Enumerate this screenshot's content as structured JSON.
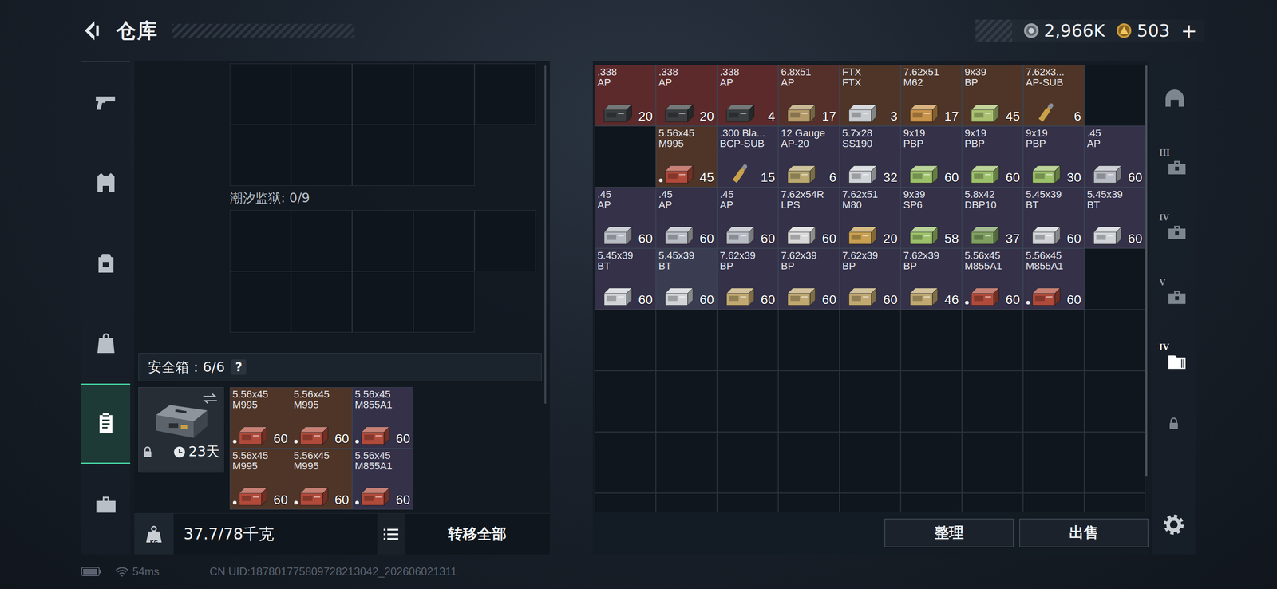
{
  "header": {
    "title": "仓库",
    "currencies": [
      {
        "kind": "silver",
        "value": "2,966K"
      },
      {
        "kind": "gold",
        "value": "503"
      }
    ],
    "add": "+"
  },
  "nav": [
    {
      "kind": "pistol",
      "selected": false
    },
    {
      "kind": "vest",
      "selected": false
    },
    {
      "kind": "rig",
      "selected": false
    },
    {
      "kind": "bag",
      "selected": false
    },
    {
      "kind": "case",
      "selected": true
    },
    {
      "kind": "toolbox",
      "selected": false
    }
  ],
  "loadout": {
    "prison_label": "潮汐监狱: 0/9",
    "secure": {
      "label": "安全箱：6/6",
      "help": "?",
      "days": "23天",
      "locked": true,
      "items": [
        {
          "kind": "box",
          "caliber": "5.56x45",
          "type": "M995",
          "count": "60",
          "color": "#4e3528",
          "box_color": "#b04a3a",
          "marked": true
        },
        {
          "kind": "box",
          "caliber": "5.56x45",
          "type": "M995",
          "count": "60",
          "color": "#4e3528",
          "box_color": "#b04a3a",
          "marked": true
        },
        {
          "kind": "box",
          "caliber": "5.56x45",
          "type": "M855A1",
          "count": "60",
          "color": "#343149",
          "box_color": "#b04a3a",
          "marked": true
        },
        {
          "kind": "box",
          "caliber": "5.56x45",
          "type": "M995",
          "count": "60",
          "color": "#4e3528",
          "box_color": "#b04a3a",
          "marked": true
        },
        {
          "kind": "box",
          "caliber": "5.56x45",
          "type": "M995",
          "count": "60",
          "color": "#4e3528",
          "box_color": "#b04a3a",
          "marked": true
        },
        {
          "kind": "box",
          "caliber": "5.56x45",
          "type": "M855A1",
          "count": "60",
          "color": "#343149",
          "box_color": "#b04a3a",
          "marked": true
        }
      ]
    },
    "weight_icon": "KG",
    "weight": "37.7/78千克",
    "transfer": "转移全部"
  },
  "stash": {
    "rows": [
      [
        {
          "kind": "box",
          "caliber": ".338",
          "type": "AP",
          "count": "20",
          "color": "#5c2a2b",
          "box_color": "#3a3e40",
          "marked": false
        },
        {
          "kind": "box",
          "caliber": ".338",
          "type": "AP",
          "count": "20",
          "color": "#5c2a2b",
          "box_color": "#3a3e40",
          "marked": false
        },
        {
          "kind": "box",
          "caliber": ".338",
          "type": "AP",
          "count": "4",
          "color": "#5c2a2b",
          "box_color": "#3a3e40",
          "marked": false
        },
        {
          "kind": "box",
          "caliber": "6.8x51",
          "type": "AP",
          "count": "17",
          "color": "#55302b",
          "box_color": "#b49a68",
          "marked": false
        },
        {
          "kind": "box",
          "caliber": "FTX",
          "type": "FTX",
          "count": "3",
          "color": "#4e3528",
          "box_color": "#c8ccd0",
          "marked": false
        },
        {
          "kind": "box",
          "caliber": "7.62x51",
          "type": "M62",
          "count": "17",
          "color": "#4e3528",
          "box_color": "#c8924a",
          "marked": false
        },
        {
          "kind": "box",
          "caliber": "9x39",
          "type": "BP",
          "count": "45",
          "color": "#4e3528",
          "box_color": "#a8c070",
          "marked": false
        },
        {
          "kind": "round",
          "caliber": "7.62x3...",
          "type": "AP-SUB",
          "count": "6",
          "color": "#4e3528",
          "box_color": "#c9a24a",
          "marked": false
        },
        {
          "kind": "empty"
        }
      ],
      [
        {
          "kind": "empty"
        },
        {
          "kind": "box",
          "caliber": "5.56x45",
          "type": "M995",
          "count": "45",
          "color": "#4e3528",
          "box_color": "#b04a3a",
          "marked": true
        },
        {
          "kind": "round",
          "caliber": ".300 Bla...",
          "type": "BCP-SUB",
          "count": "15",
          "color": "#343149",
          "box_color": "#c9a24a",
          "marked": false
        },
        {
          "kind": "box",
          "caliber": "12 Gauge",
          "type": "AP-20",
          "count": "6",
          "color": "#343149",
          "box_color": "#b9a870",
          "marked": false
        },
        {
          "kind": "box",
          "caliber": "5.7x28",
          "type": "SS190",
          "count": "32",
          "color": "#343149",
          "box_color": "#d0d4d8",
          "marked": false
        },
        {
          "kind": "box",
          "caliber": "9x19",
          "type": "PBP",
          "count": "60",
          "color": "#343149",
          "box_color": "#9cc06a",
          "marked": false
        },
        {
          "kind": "box",
          "caliber": "9x19",
          "type": "PBP",
          "count": "60",
          "color": "#343149",
          "box_color": "#9cc06a",
          "marked": false
        },
        {
          "kind": "box",
          "caliber": "9x19",
          "type": "PBP",
          "count": "30",
          "color": "#343149",
          "box_color": "#9cc06a",
          "marked": false
        },
        {
          "kind": "box",
          "caliber": ".45",
          "type": "AP",
          "count": "60",
          "color": "#343149",
          "box_color": "#b8bcc4",
          "marked": false
        }
      ],
      [
        {
          "kind": "box",
          "caliber": ".45",
          "type": "AP",
          "count": "60",
          "color": "#343149",
          "box_color": "#b8bcc4",
          "marked": false
        },
        {
          "kind": "box",
          "caliber": ".45",
          "type": "AP",
          "count": "60",
          "color": "#343149",
          "box_color": "#b8bcc4",
          "marked": false
        },
        {
          "kind": "box",
          "caliber": ".45",
          "type": "AP",
          "count": "60",
          "color": "#343149",
          "box_color": "#b8bcc4",
          "marked": false
        },
        {
          "kind": "box",
          "caliber": "7.62x54R",
          "type": "LPS",
          "count": "60",
          "color": "#343149",
          "box_color": "#d8d8d8",
          "marked": false
        },
        {
          "kind": "box",
          "caliber": "7.62x51",
          "type": "M80",
          "count": "20",
          "color": "#343149",
          "box_color": "#c8a050",
          "marked": false
        },
        {
          "kind": "box",
          "caliber": "9x39",
          "type": "SP6",
          "count": "58",
          "color": "#343149",
          "box_color": "#9cc06a",
          "marked": false
        },
        {
          "kind": "box",
          "caliber": "5.8x42",
          "type": "DBP10",
          "count": "37",
          "color": "#343149",
          "box_color": "#7fa060",
          "marked": false
        },
        {
          "kind": "box",
          "caliber": "5.45x39",
          "type": "BT",
          "count": "60",
          "color": "#343149",
          "box_color": "#d0d4d8",
          "marked": false
        },
        {
          "kind": "box",
          "caliber": "5.45x39",
          "type": "BT",
          "count": "60",
          "color": "#343149",
          "box_color": "#d0d4d8",
          "marked": false
        }
      ],
      [
        {
          "kind": "box",
          "caliber": "5.45x39",
          "type": "BT",
          "count": "60",
          "color": "#343149",
          "box_color": "#d0d4d8",
          "marked": false
        },
        {
          "kind": "box",
          "caliber": "5.45x39",
          "type": "BT",
          "count": "60",
          "color": "#3a3d52",
          "box_color": "#d0d4d8",
          "marked": false
        },
        {
          "kind": "box",
          "caliber": "7.62x39",
          "type": "BP",
          "count": "60",
          "color": "#343149",
          "box_color": "#c0a870",
          "marked": false
        },
        {
          "kind": "box",
          "caliber": "7.62x39",
          "type": "BP",
          "count": "60",
          "color": "#343149",
          "box_color": "#c0a870",
          "marked": false
        },
        {
          "kind": "box",
          "caliber": "7.62x39",
          "type": "BP",
          "count": "60",
          "color": "#343149",
          "box_color": "#c0a870",
          "marked": false
        },
        {
          "kind": "box",
          "caliber": "7.62x39",
          "type": "BP",
          "count": "46",
          "color": "#343149",
          "box_color": "#c0a870",
          "marked": false
        },
        {
          "kind": "box",
          "caliber": "5.56x45",
          "type": "M855A1",
          "count": "60",
          "color": "#343149",
          "box_color": "#b04a3a",
          "marked": true
        },
        {
          "kind": "box",
          "caliber": "5.56x45",
          "type": "M855A1",
          "count": "60",
          "color": "#343149",
          "box_color": "#b04a3a",
          "marked": true
        },
        {
          "kind": "empty"
        }
      ]
    ]
  },
  "actions": [
    {
      "label": "整理"
    },
    {
      "label": "出售"
    }
  ],
  "side_tabs": [
    {
      "kind": "raid",
      "selected": false
    },
    {
      "kind": "case",
      "badge": "III",
      "selected": false
    },
    {
      "kind": "case",
      "badge": "IV",
      "selected": false
    },
    {
      "kind": "case",
      "badge": "V",
      "selected": false
    },
    {
      "kind": "folder",
      "badge": "IV",
      "selected": true
    },
    {
      "kind": "lock",
      "selected": false
    },
    {
      "kind": "gear",
      "selected": false
    }
  ],
  "status": {
    "ping": "54ms",
    "uid": "CN UID:187801775809728213042_202606021311"
  }
}
